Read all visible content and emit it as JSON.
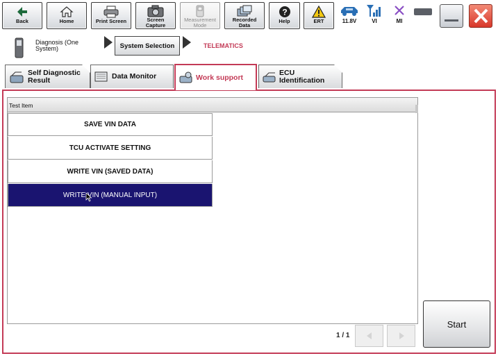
{
  "toolbar": {
    "back": "Back",
    "home": "Home",
    "print_screen": "Print Screen",
    "screen_capture": "Screen Capture",
    "measurement_mode": "Measurement Mode",
    "recorded_data": "Recorded Data",
    "help": "Help",
    "ert": "ERT"
  },
  "status": {
    "battery_voltage": "11.8V",
    "vi": "VI",
    "mi": "MI"
  },
  "breadcrumb": {
    "diagnosis": "Diagnosis (One System)",
    "system_selection": "System Selection",
    "current": "TELEMATICS"
  },
  "tabs": {
    "self_diagnostic": "Self Diagnostic Result",
    "data_monitor": "Data Monitor",
    "work_support": "Work support",
    "ecu_identification": "ECU Identification"
  },
  "table": {
    "header": "Test Item",
    "items": [
      "SAVE VIN DATA",
      "TCU ACTIVATE SETTING",
      "WRITE VIN (SAVED DATA)",
      "WRITE VIN (MANUAL INPUT)"
    ],
    "selected_index": 3
  },
  "pagination": {
    "page": "1 / 1"
  },
  "start_label": "Start",
  "colors": {
    "accent": "#c33a56",
    "selected_row": "#1a1470",
    "status_icon": "#2a6fb5",
    "mi_icon": "#8a4fc4"
  },
  "icons": {
    "back": "back-arrow-icon",
    "home": "home-icon",
    "print": "printer-icon",
    "capture": "camera-icon",
    "measure": "meter-icon",
    "recorded": "data-stack-icon",
    "help": "help-icon",
    "ert": "warning-icon"
  }
}
